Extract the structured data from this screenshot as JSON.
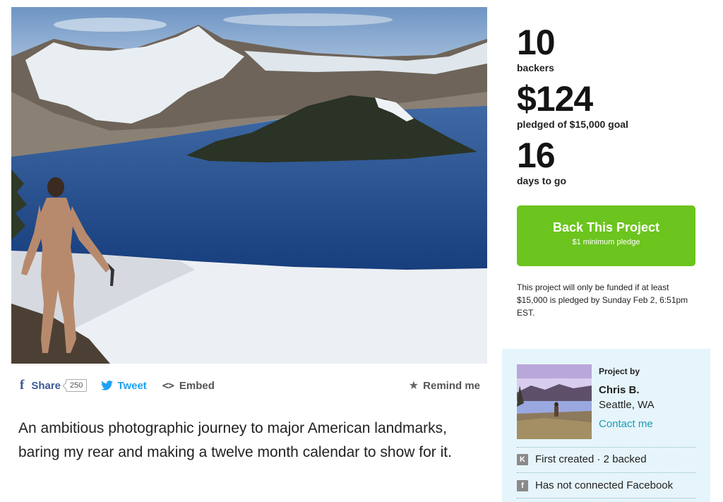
{
  "share_bar": {
    "facebook_label": "Share",
    "facebook_count": "250",
    "tweet_label": "Tweet",
    "embed_label": "Embed",
    "remind_label": "Remind me",
    "icons": {
      "facebook": "facebook-icon",
      "twitter": "twitter-icon",
      "embed": "embed-code-icon",
      "remind": "star-icon"
    }
  },
  "blurb": "An ambitious photographic journey to major American landmarks, baring my rear and making a twelve month calendar to show for it.",
  "stats": {
    "backers_count": "10",
    "backers_label": "backers",
    "pledged_amount": "$124",
    "pledged_label": "pledged of $15,000 goal",
    "days_count": "16",
    "days_label": "days to go"
  },
  "back_button": {
    "title": "Back This Project",
    "subtitle": "$1 minimum pledge",
    "color": "#6cc41e"
  },
  "funding_note": "This project will only be funded if at least $15,000 is pledged by Sunday Feb 2, 6:51pm EST.",
  "creator": {
    "heading": "Project by",
    "name": "Chris B.",
    "location": "Seattle, WA",
    "contact_label": "Contact me",
    "first_created": "First created · 2 backed",
    "facebook_status": "Has not connected Facebook",
    "icons": {
      "kickstarter": "kickstarter-icon",
      "facebook": "facebook-icon"
    },
    "panel_color": "#e6f5fb",
    "link_color": "#1a9bb5"
  }
}
